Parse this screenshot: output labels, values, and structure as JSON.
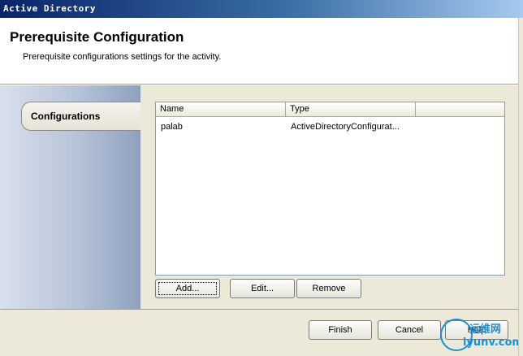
{
  "window": {
    "title": "Active Directory"
  },
  "header": {
    "title": "Prerequisite Configuration",
    "subtitle": "Prerequisite configurations settings for the activity."
  },
  "sidebar": {
    "items": [
      {
        "label": "Configurations",
        "selected": true
      }
    ]
  },
  "listview": {
    "columns": [
      "Name",
      "Type",
      ""
    ],
    "rows": [
      {
        "name": "palab",
        "type": "ActiveDirectoryConfigurat..."
      }
    ]
  },
  "actions": {
    "add_label": "Add...",
    "edit_label": "Edit...",
    "remove_label": "Remove"
  },
  "footer": {
    "finish_label": "Finish",
    "cancel_label": "Cancel",
    "help_label": "Help"
  },
  "watermark": {
    "line1": "运维网",
    "line2": "iyunv.com"
  }
}
